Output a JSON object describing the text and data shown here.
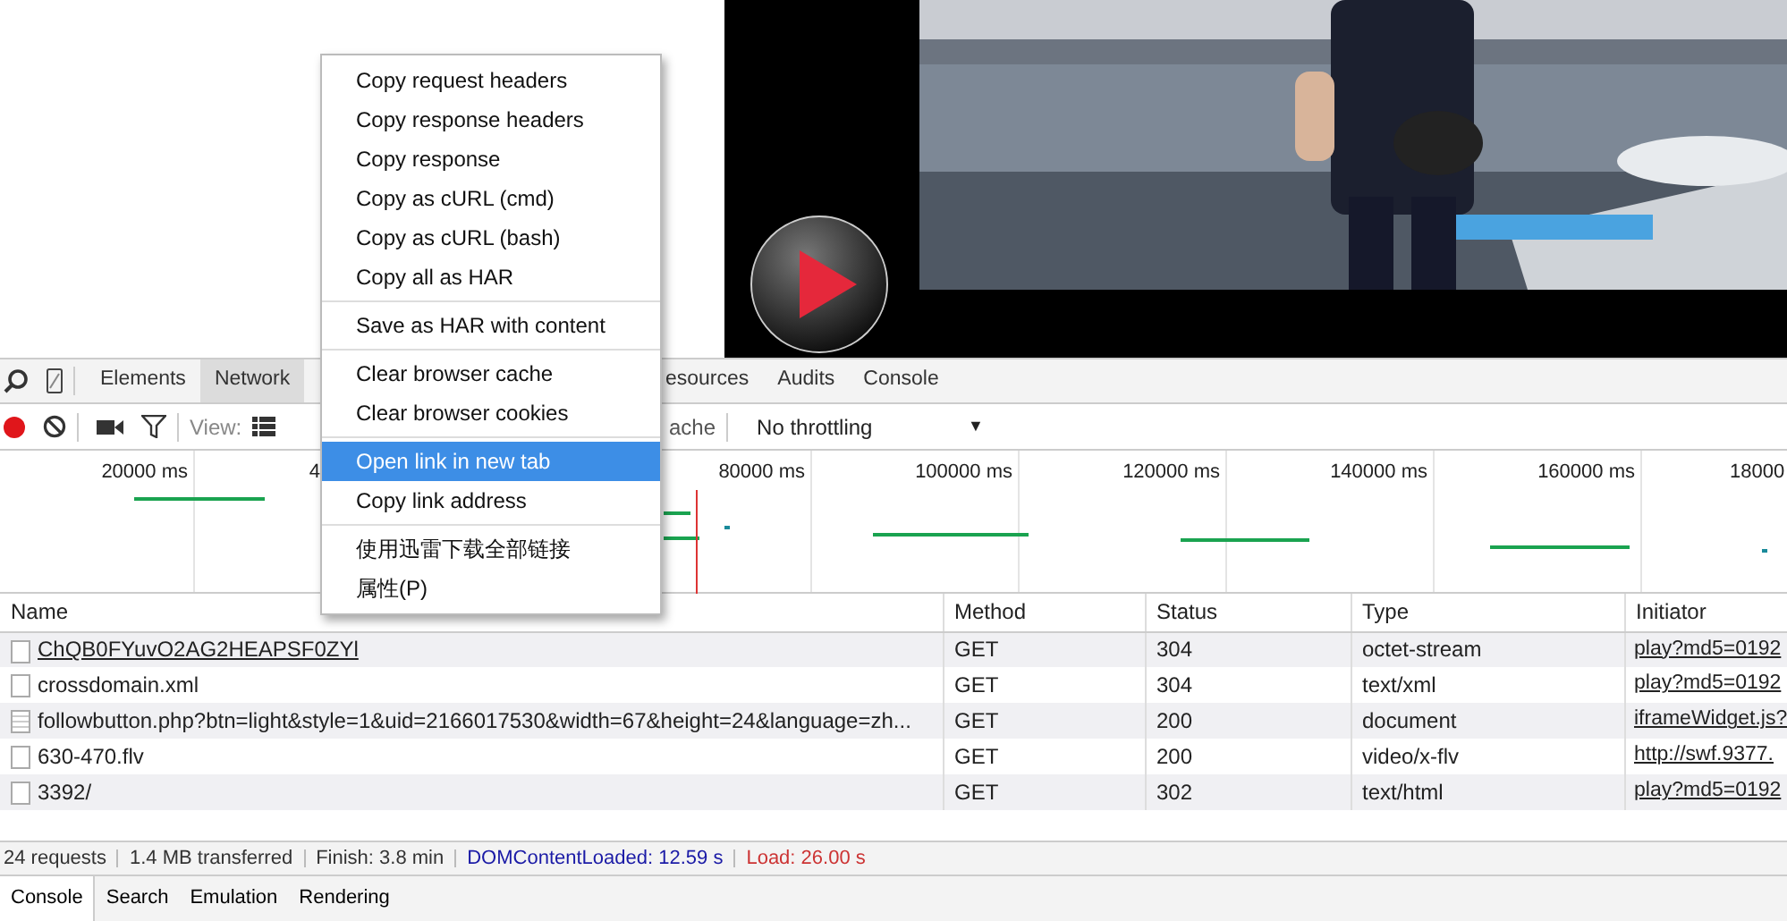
{
  "video": {
    "kind": "picture"
  },
  "devtools_tabs": [
    {
      "label": "Elements",
      "selected": false
    },
    {
      "label": "Network",
      "selected": true
    },
    {
      "label": "esources",
      "selected": false,
      "kind": "after-menu"
    },
    {
      "label": "Audits",
      "selected": false
    },
    {
      "label": "Console",
      "selected": false
    }
  ],
  "toolbar": {
    "recording": true,
    "view_label": "View:",
    "cache_label": "ache",
    "throttling": "No throttling",
    "dropdown_arrow": "▼"
  },
  "timeline_ticks": [
    "20000 ms",
    "4",
    "80000 ms",
    "100000 ms",
    "120000 ms",
    "140000 ms",
    "160000 ms",
    "18000"
  ],
  "table": {
    "columns": [
      "Name",
      "Method",
      "Status",
      "Type",
      "Initiator"
    ],
    "rows": [
      {
        "name": "ChQB0FYuvO2AG2HEAPSF0ZYl",
        "method": "GET",
        "status": "304",
        "type": "octet-stream",
        "initiator": "play?md5=0192",
        "kind": "media"
      },
      {
        "name": "crossdomain.xml",
        "method": "GET",
        "status": "304",
        "type": "text/xml",
        "initiator": "play?md5=0192",
        "kind": "file"
      },
      {
        "name": "followbutton.php?btn=light&style=1&uid=2166017530&width=67&height=24&language=zh...",
        "method": "GET",
        "status": "200",
        "type": "document",
        "initiator": "iframeWidget.js?",
        "kind": "document"
      },
      {
        "name": "630-470.flv",
        "method": "GET",
        "status": "200",
        "type": "video/x-flv",
        "initiator": "http://swf.9377.",
        "kind": "file"
      },
      {
        "name": "3392/",
        "method": "GET",
        "status": "302",
        "type": "text/html",
        "initiator": "play?md5=0192",
        "kind": "file"
      }
    ]
  },
  "status_bar": [
    {
      "text": "24 requests",
      "kind": "plain"
    },
    {
      "text": "1.4 MB transferred",
      "kind": "plain"
    },
    {
      "text": "Finish: 3.8 min",
      "kind": "plain"
    },
    {
      "text": "DOMContentLoaded: 12.59 s",
      "kind": "dom"
    },
    {
      "text": "Load: 26.00 s",
      "kind": "load"
    }
  ],
  "drawer_tabs": [
    {
      "label": "Console",
      "selected": true
    },
    {
      "label": "Search",
      "selected": false
    },
    {
      "label": "Emulation",
      "selected": false
    },
    {
      "label": "Rendering",
      "selected": false
    }
  ],
  "context_menu": [
    [
      {
        "label": "Copy request headers",
        "selected": false
      },
      {
        "label": "Copy response headers",
        "selected": false
      },
      {
        "label": "Copy response",
        "selected": false
      },
      {
        "label": "Copy as cURL (cmd)",
        "selected": false
      },
      {
        "label": "Copy as cURL (bash)",
        "selected": false
      },
      {
        "label": "Copy all as HAR",
        "selected": false
      }
    ],
    [
      {
        "label": "Save as HAR with content",
        "selected": false
      }
    ],
    [
      {
        "label": "Clear browser cache",
        "selected": false
      },
      {
        "label": "Clear browser cookies",
        "selected": false
      }
    ],
    [
      {
        "label": "Open link in new tab",
        "selected": true
      },
      {
        "label": "Copy link address",
        "selected": false
      }
    ],
    [
      {
        "label": "使用迅雷下载全部链接",
        "selected": false
      },
      {
        "label": "属性(P)",
        "selected": false
      }
    ]
  ]
}
